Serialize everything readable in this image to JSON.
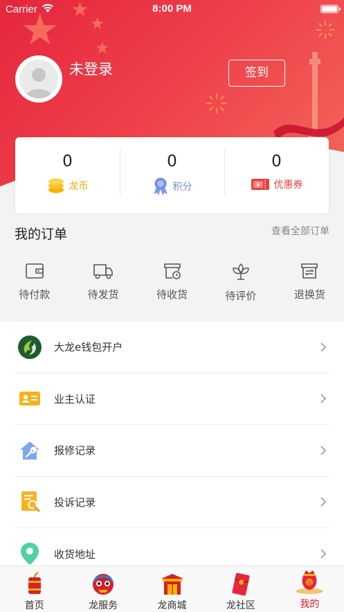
{
  "status_bar": {
    "carrier": "Carrier",
    "time": "8:00 PM"
  },
  "profile": {
    "username": "未登录",
    "signin_label": "签到"
  },
  "stats": [
    {
      "value": "0",
      "label": "龙币",
      "icon": "coin-stack-icon",
      "color": "#f5b400"
    },
    {
      "value": "0",
      "label": "积分",
      "icon": "medal-icon",
      "color": "#6f8fe6"
    },
    {
      "value": "0",
      "label": "优惠券",
      "icon": "coupon-icon",
      "color": "#e6423b"
    }
  ],
  "orders": {
    "title": "我的订单",
    "view_all": "查看全部订单",
    "items": [
      {
        "label": "待付款",
        "icon": "wallet-icon"
      },
      {
        "label": "待发货",
        "icon": "truck-icon"
      },
      {
        "label": "待收货",
        "icon": "box-clock-icon"
      },
      {
        "label": "待评价",
        "icon": "flower-icon"
      },
      {
        "label": "退换货",
        "icon": "exchange-box-icon"
      }
    ]
  },
  "menu": [
    {
      "label": "大龙e钱包开户",
      "icon": "wallet-logo-icon"
    },
    {
      "label": "业主认证",
      "icon": "id-card-icon"
    },
    {
      "label": "报修记录",
      "icon": "repair-house-icon"
    },
    {
      "label": "投诉记录",
      "icon": "complaint-doc-icon"
    },
    {
      "label": "收货地址",
      "icon": "location-pin-icon"
    }
  ],
  "tabs": [
    {
      "label": "首页",
      "icon": "firecracker-icon"
    },
    {
      "label": "龙服务",
      "icon": "lion-dance-icon"
    },
    {
      "label": "龙商城",
      "icon": "gate-icon"
    },
    {
      "label": "龙社区",
      "icon": "red-envelope-icon"
    },
    {
      "label": "我的",
      "icon": "lucky-bag-icon",
      "active": true
    }
  ],
  "colors": {
    "brand_red": "#e5263d",
    "active_tab": "#d81e2c"
  }
}
